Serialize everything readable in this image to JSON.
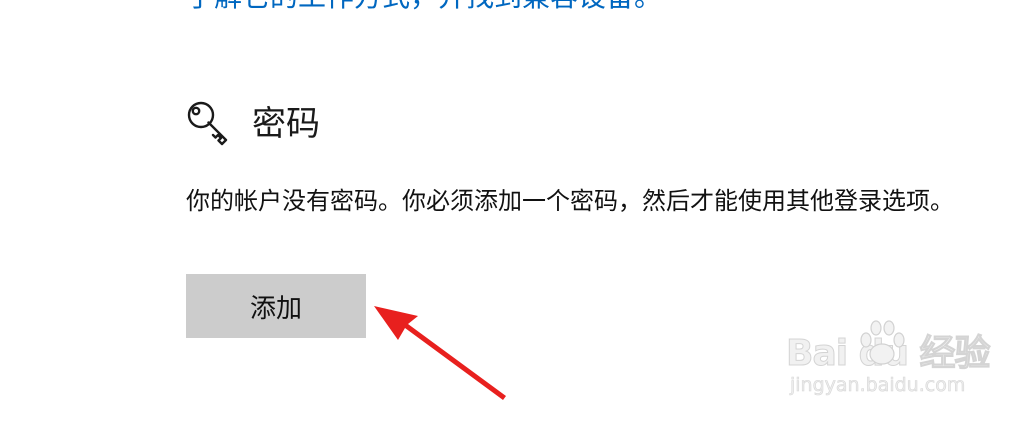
{
  "top_link": {
    "text": "了解它的工作方式，并找到兼容设备。",
    "color": "#0067c0"
  },
  "password_section": {
    "icon": "key-icon",
    "title": "密码",
    "description": "你的帐户没有密码。你必须添加一个密码，然后才能使用其他登录选项。",
    "add_button_label": "添加"
  },
  "annotation": {
    "icon": "red-arrow-icon",
    "color": "#e8201e"
  },
  "watermark": {
    "logo_text": "Bai du 经验",
    "url": "jingyan.baidu.com"
  }
}
